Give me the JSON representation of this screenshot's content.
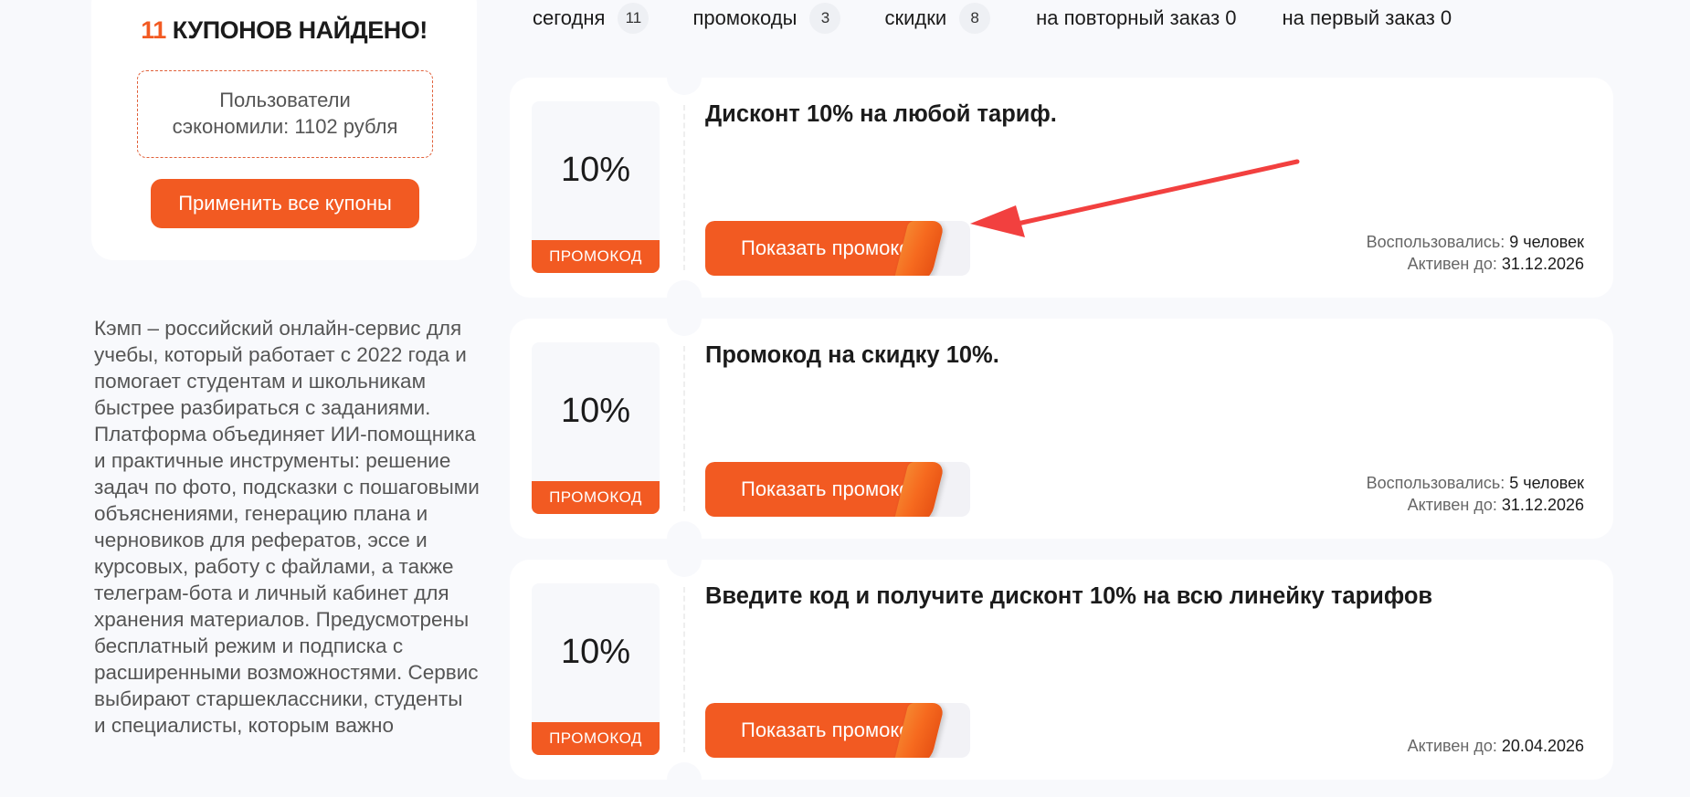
{
  "sidebar": {
    "found_count": "11",
    "found_text": " КУПОНОВ НАЙДЕНО!",
    "savings_line1": "Пользователи",
    "savings_line2": "сэкономили: 1102 рубля",
    "apply_all_label": "Применить все купоны",
    "description": "Кэмп – российский онлайн-сервис для учебы, который работает с 2022 года и помогает студентам и школьникам быстрее разбираться с заданиями. Платформа объединяет ИИ-помощника и практичные инструменты: решение задач по фото, подсказки с пошаговыми объяснениями, генерацию плана и черновиков для рефератов, эссе и курсовых, работу с файлами, а также телеграм-бота и личный кабинет для хранения материалов. Предусмотрены бесплатный режим и подписка с расширенными возможностями. Сервис выбирают старшеклассники, студенты и специалисты, которым важно"
  },
  "filters": {
    "today": {
      "label": "сегодня",
      "count": "11"
    },
    "promocodes": {
      "label": "промокоды",
      "count": "3"
    },
    "discounts": {
      "label": "скидки",
      "count": "8"
    },
    "repeat_order": {
      "label": "на повторный заказ 0"
    },
    "first_order": {
      "label": "на первый заказ 0"
    }
  },
  "coupons": [
    {
      "value": "10%",
      "type_label": "ПРОМОКОД",
      "title": "Дисконт 10% на любой тариф.",
      "button_label": "Показать промокод",
      "used_label": "Воспользовались:",
      "used_value": "9 человек",
      "active_label": "Активен до:",
      "active_value": "31.12.2026"
    },
    {
      "value": "10%",
      "type_label": "ПРОМОКОД",
      "title": "Промокод на скидку 10%.",
      "button_label": "Показать промокод",
      "used_label": "Воспользовались:",
      "used_value": "5 человек",
      "active_label": "Активен до:",
      "active_value": "31.12.2026"
    },
    {
      "value": "10%",
      "type_label": "ПРОМОКОД",
      "title": "Введите код и получите дисконт 10% на всю линейку тарифов",
      "button_label": "Показать промокод",
      "active_label": "Активен до:",
      "active_value": "20.04.2026"
    }
  ],
  "colors": {
    "accent": "#f25a22",
    "annotation_arrow": "#f2403f"
  },
  "icons": {
    "annotation": "red-arrow-icon"
  }
}
